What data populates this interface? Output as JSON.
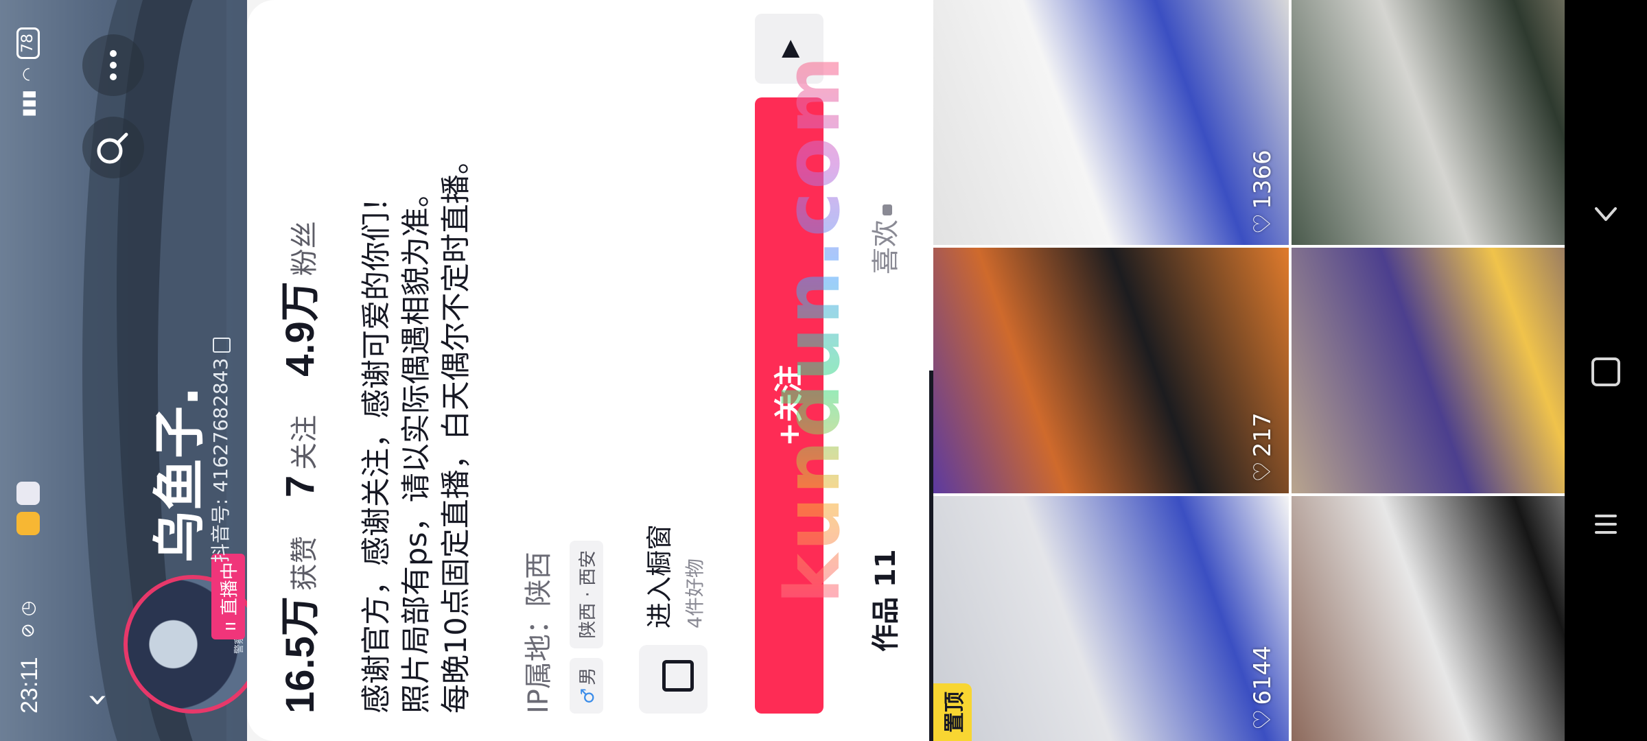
{
  "status_bar": {
    "time": "23:11",
    "battery": "78"
  },
  "profile": {
    "nickname": "乌鱼子.",
    "douyin_id": "抖音号: 41627682843",
    "live_badge": "直播中",
    "avatar_text": "警察"
  },
  "stats": [
    {
      "value": "16.5万",
      "label": "获赞"
    },
    {
      "value": "7",
      "label": "关注"
    },
    {
      "value": "4.9万",
      "label": "粉丝"
    }
  ],
  "bio": [
    "感谢官方，感谢关注，感谢可爱的你们！",
    "照片局部有ps，请以实际偶遇相貌为准。",
    "每晚10点固定直播，白天偶尔不定时直播。"
  ],
  "ip_location": "IP属地：陕西",
  "tags": {
    "gender": "男",
    "gender_symbol": "♂",
    "location": "陕西 · 西安"
  },
  "shop": {
    "title": "进入橱窗",
    "subtitle": "4件好物"
  },
  "buttons": {
    "follow": "+关注",
    "play_icon": "▶"
  },
  "tabs": {
    "works": "作品 11",
    "likes": "喜欢"
  },
  "videos": [
    {
      "likes": "6144",
      "pinned": true,
      "pin_label": "置顶"
    },
    {
      "likes": "217",
      "pinned": false
    },
    {
      "likes": "1366",
      "pinned": false
    },
    {
      "likes": "",
      "pinned": false
    },
    {
      "likes": "",
      "pinned": false
    },
    {
      "likes": "",
      "pinned": false
    }
  ],
  "watermark": "kundun.com",
  "icons": {
    "back": "chevron-left-icon",
    "search": "search-icon",
    "more": "more-dots-icon",
    "heart": "heart-icon",
    "lock": "lock-icon",
    "shop": "shopping-bag-icon"
  },
  "colors": {
    "follow_button": "#fe2c55",
    "live_badge": "#f0357a",
    "pin_badge": "#f8d632"
  }
}
